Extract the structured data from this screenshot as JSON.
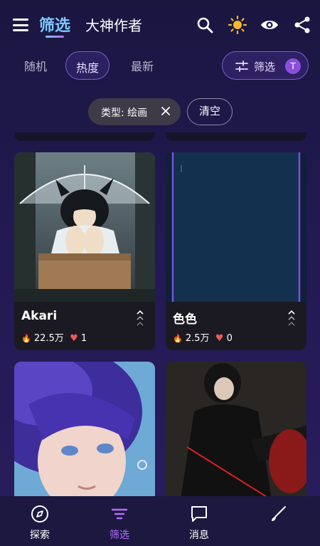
{
  "header": {
    "tab_filter": "筛选",
    "tab_authors": "大神作者"
  },
  "sort": {
    "random": "随机",
    "hot": "热度",
    "latest": "最新",
    "filter_label": "筛选",
    "filter_badge": "T"
  },
  "chips": {
    "type_chip": "类型: 绘画",
    "clear": "清空"
  },
  "cards": [
    {
      "title": "Akari",
      "views": "22.5万",
      "likes": "1"
    },
    {
      "title": "色色",
      "views": "2.5万",
      "likes": "0"
    }
  ],
  "nav": {
    "explore": "探索",
    "filter": "筛选",
    "messages": "消息",
    "create": ""
  },
  "colors": {
    "accent": "#b46dff",
    "tab_active": "#7ec8ff",
    "background": "#221a52"
  }
}
